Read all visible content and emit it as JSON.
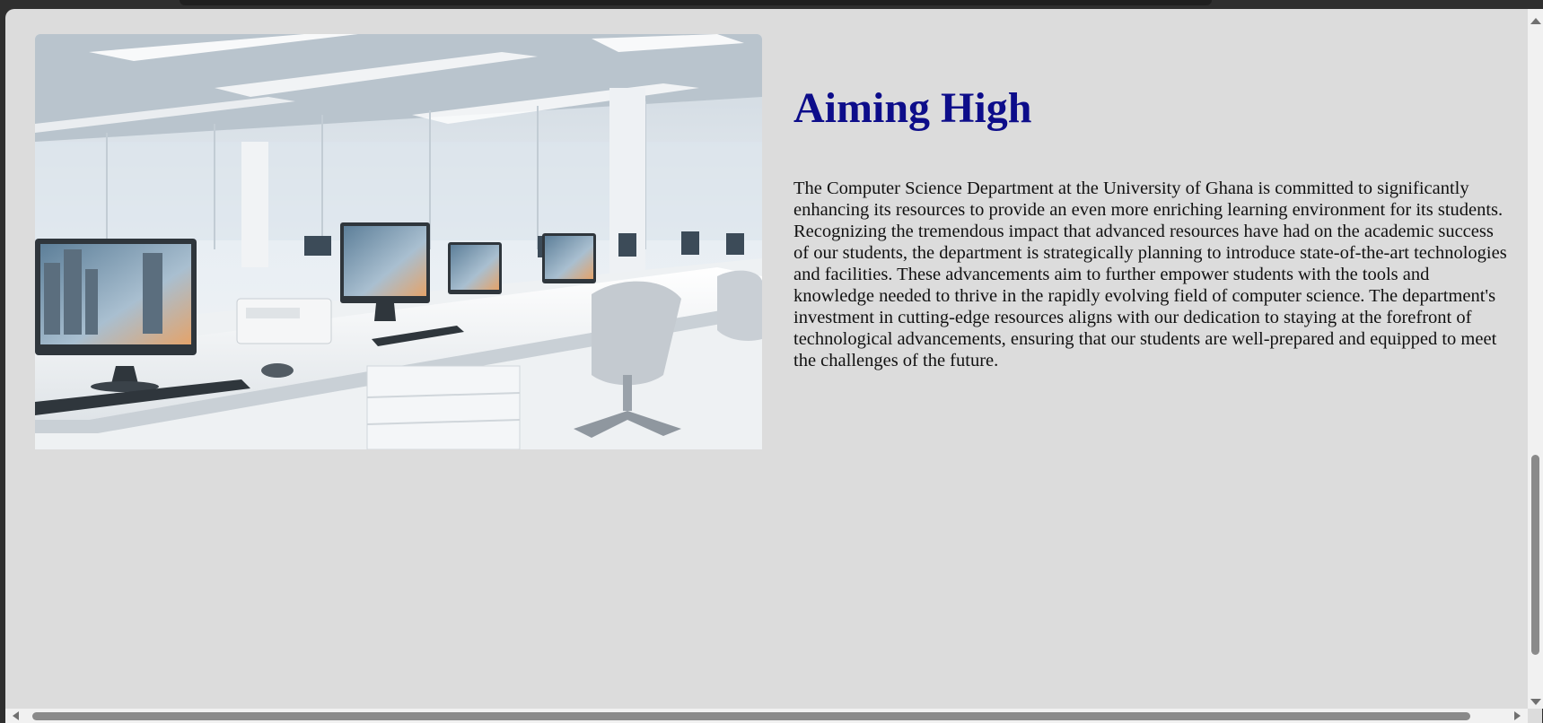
{
  "section": {
    "heading": "Aiming High",
    "paragraph": "The Computer Science Department at the University of Ghana is committed to significantly enhancing its resources to provide an even more enriching learning environment for its students. Recognizing the tremendous impact that advanced resources have had on the academic success of our students, the department is strategically planning to introduce state-of-the-art technologies and facilities. These advancements aim to further empower students with the tools and knowledge needed to thrive in the rapidly evolving field of computer science. The department's investment in cutting-edge resources aligns with our dedication to staying at the forefront of technological advancements, ensuring that our students are well-prepared and equipped to meet the challenges of the future.",
    "image": {
      "subject": "modern-computer-lab-photo"
    }
  },
  "colors": {
    "page_background": "#dcdcdc",
    "heading_color": "#0d0d8a",
    "text_color": "#111111",
    "scrollbar_thumb": "#8a8a8a"
  },
  "scroll": {
    "vertical_position": 0.78,
    "horizontal_position": 0.0
  }
}
